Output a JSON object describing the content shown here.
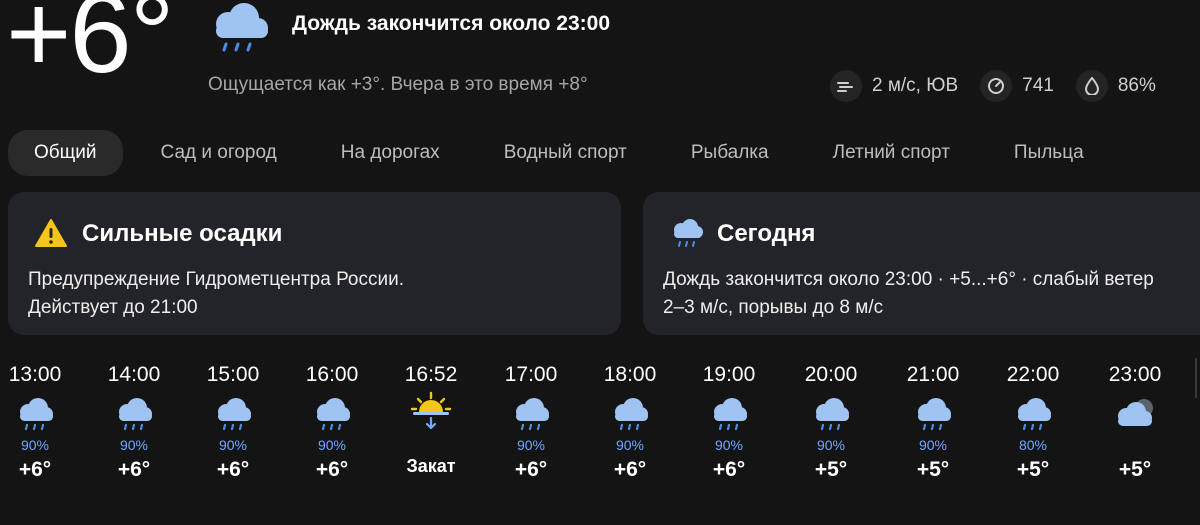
{
  "current": {
    "temperature": "+6°",
    "condition_icon": "rain-cloud-icon",
    "headline": "Дождь закончится около 23:00",
    "feels_like": "Ощущается как +3°. Вчера в это время +8°",
    "wind": "2 м/с, ЮВ",
    "pressure": "741",
    "humidity": "86%"
  },
  "tabs": [
    {
      "label": "Общий",
      "active": true
    },
    {
      "label": "Сад и огород",
      "active": false
    },
    {
      "label": "На дорогах",
      "active": false
    },
    {
      "label": "Водный спорт",
      "active": false
    },
    {
      "label": "Рыбалка",
      "active": false
    },
    {
      "label": "Летний спорт",
      "active": false
    },
    {
      "label": "Пыльца",
      "active": false
    }
  ],
  "alert_card": {
    "icon": "warning-icon",
    "title": "Сильные осадки",
    "line1": "Предупреждение Гидрометцентра России.",
    "line2": "Действует до 21:00"
  },
  "today_card": {
    "icon": "rain-cloud-icon",
    "title": "Сегодня",
    "line1": "Дождь закончится около 23:00 · +5...+6° · слабый ветер",
    "line2": "2–3 м/с, порывы до 8 м/с"
  },
  "hourly": [
    {
      "time": "13:00",
      "icon": "rain-cloud-icon",
      "prob": "90%",
      "temp": "+6°"
    },
    {
      "time": "14:00",
      "icon": "rain-cloud-icon",
      "prob": "90%",
      "temp": "+6°"
    },
    {
      "time": "15:00",
      "icon": "rain-cloud-icon",
      "prob": "90%",
      "temp": "+6°"
    },
    {
      "time": "16:00",
      "icon": "rain-cloud-icon",
      "prob": "90%",
      "temp": "+6°"
    },
    {
      "time": "16:52",
      "icon": "sunset-icon",
      "label": "Закат"
    },
    {
      "time": "17:00",
      "icon": "rain-cloud-icon",
      "prob": "90%",
      "temp": "+6°"
    },
    {
      "time": "18:00",
      "icon": "rain-cloud-icon",
      "prob": "90%",
      "temp": "+6°"
    },
    {
      "time": "19:00",
      "icon": "rain-cloud-icon",
      "prob": "90%",
      "temp": "+6°"
    },
    {
      "time": "20:00",
      "icon": "rain-cloud-icon",
      "prob": "90%",
      "temp": "+5°"
    },
    {
      "time": "21:00",
      "icon": "rain-cloud-icon",
      "prob": "90%",
      "temp": "+5°"
    },
    {
      "time": "22:00",
      "icon": "rain-cloud-icon",
      "prob": "80%",
      "temp": "+5°"
    },
    {
      "time": "23:00",
      "icon": "cloudy-night-icon",
      "temp": "+5°"
    }
  ],
  "colors": {
    "background": "#141414",
    "card": "#232429",
    "precip_blue": "#6fa8ff",
    "cloud": "#8fb6e8",
    "warning": "#f5c518"
  }
}
